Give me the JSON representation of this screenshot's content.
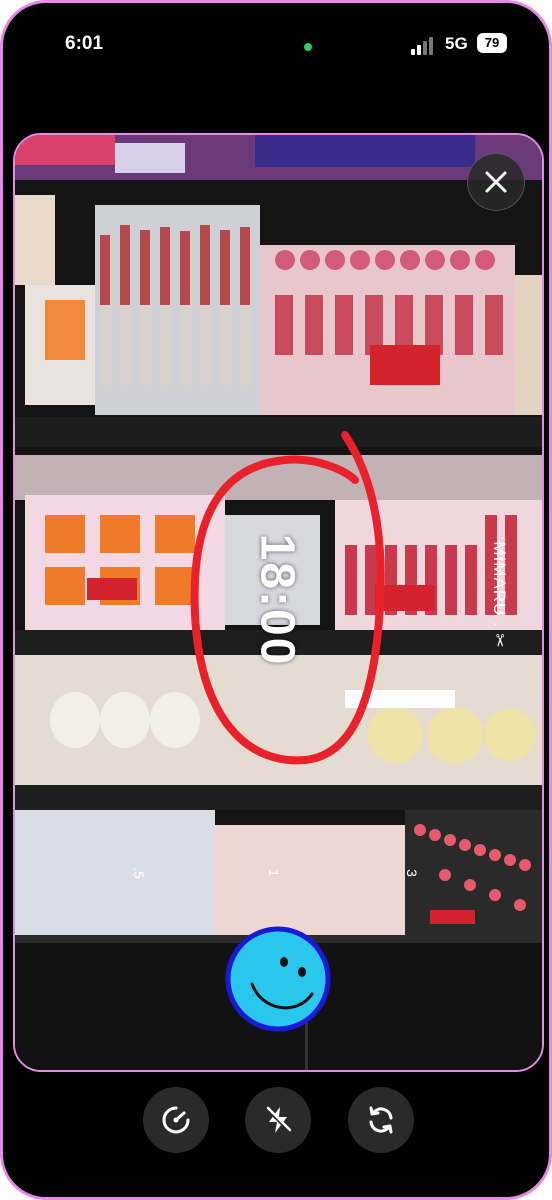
{
  "status_bar": {
    "time": "6:01",
    "network": "5G",
    "battery": "79"
  },
  "camera": {
    "timer_label": "18:00",
    "watermark": "MIMARU . ✂",
    "zoom_marks": [
      ".5",
      "1",
      "3"
    ]
  },
  "controls": {
    "icons": [
      "speed-icon",
      "flash-icon",
      "flip-camera-icon"
    ]
  },
  "colors": {
    "frame_border": "#e58ae6",
    "annotation_red": "#e8212a",
    "smiley_fill": "#29c6ee",
    "smiley_outline": "#1a1ad6"
  }
}
